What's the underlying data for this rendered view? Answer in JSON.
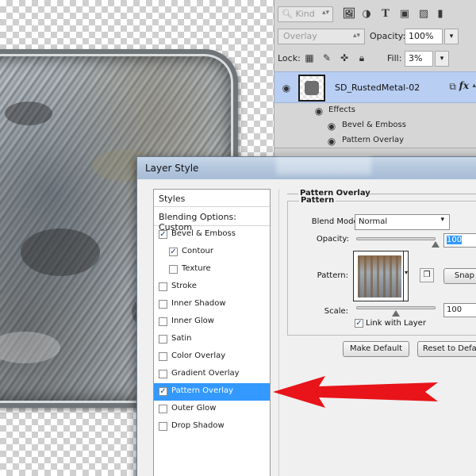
{
  "layers_panel": {
    "kind_label": "Kind",
    "blend_mode": "Overlay",
    "opacity_label": "Opacity:",
    "opacity_value": "100%",
    "lock_label": "Lock:",
    "fill_label": "Fill:",
    "fill_value": "3%",
    "layer": {
      "name": "SD_RustedMetal-02",
      "fx_label": "fx"
    },
    "effects_label": "Effects",
    "effects": [
      "Bevel & Emboss",
      "Pattern Overlay"
    ]
  },
  "dialog": {
    "title": "Layer Style",
    "styles_header": "Styles",
    "blending_options": "Blending Options: Custom",
    "style_items": [
      {
        "label": "Bevel & Emboss",
        "checked": true,
        "sub": false,
        "selected": false
      },
      {
        "label": "Contour",
        "checked": true,
        "sub": true,
        "selected": false
      },
      {
        "label": "Texture",
        "checked": false,
        "sub": true,
        "selected": false
      },
      {
        "label": "Stroke",
        "checked": false,
        "sub": false,
        "selected": false
      },
      {
        "label": "Inner Shadow",
        "checked": false,
        "sub": false,
        "selected": false
      },
      {
        "label": "Inner Glow",
        "checked": false,
        "sub": false,
        "selected": false
      },
      {
        "label": "Satin",
        "checked": false,
        "sub": false,
        "selected": false
      },
      {
        "label": "Color Overlay",
        "checked": false,
        "sub": false,
        "selected": false
      },
      {
        "label": "Gradient Overlay",
        "checked": false,
        "sub": false,
        "selected": false
      },
      {
        "label": "Pattern Overlay",
        "checked": true,
        "sub": false,
        "selected": true
      },
      {
        "label": "Outer Glow",
        "checked": false,
        "sub": false,
        "selected": false
      },
      {
        "label": "Drop Shadow",
        "checked": false,
        "sub": false,
        "selected": false
      }
    ],
    "group_title": "Pattern Overlay",
    "inner_title": "Pattern",
    "blend_mode_label": "Blend Mode:",
    "blend_mode_value": "Normal",
    "opacity_label": "Opacity:",
    "opacity_value": "100",
    "opacity_level": 1.0,
    "pattern_label": "Pattern:",
    "snap_button": "Snap t",
    "scale_label": "Scale:",
    "scale_value": "100",
    "scale_level": 0.5,
    "link_with_layer": "Link with Layer",
    "make_default": "Make Default",
    "reset_default": "Reset to Defau"
  },
  "colors": {
    "selection_blue": "#3399ff",
    "layer_highlight": "#b8cef2",
    "arrow_red": "#e8141a"
  }
}
